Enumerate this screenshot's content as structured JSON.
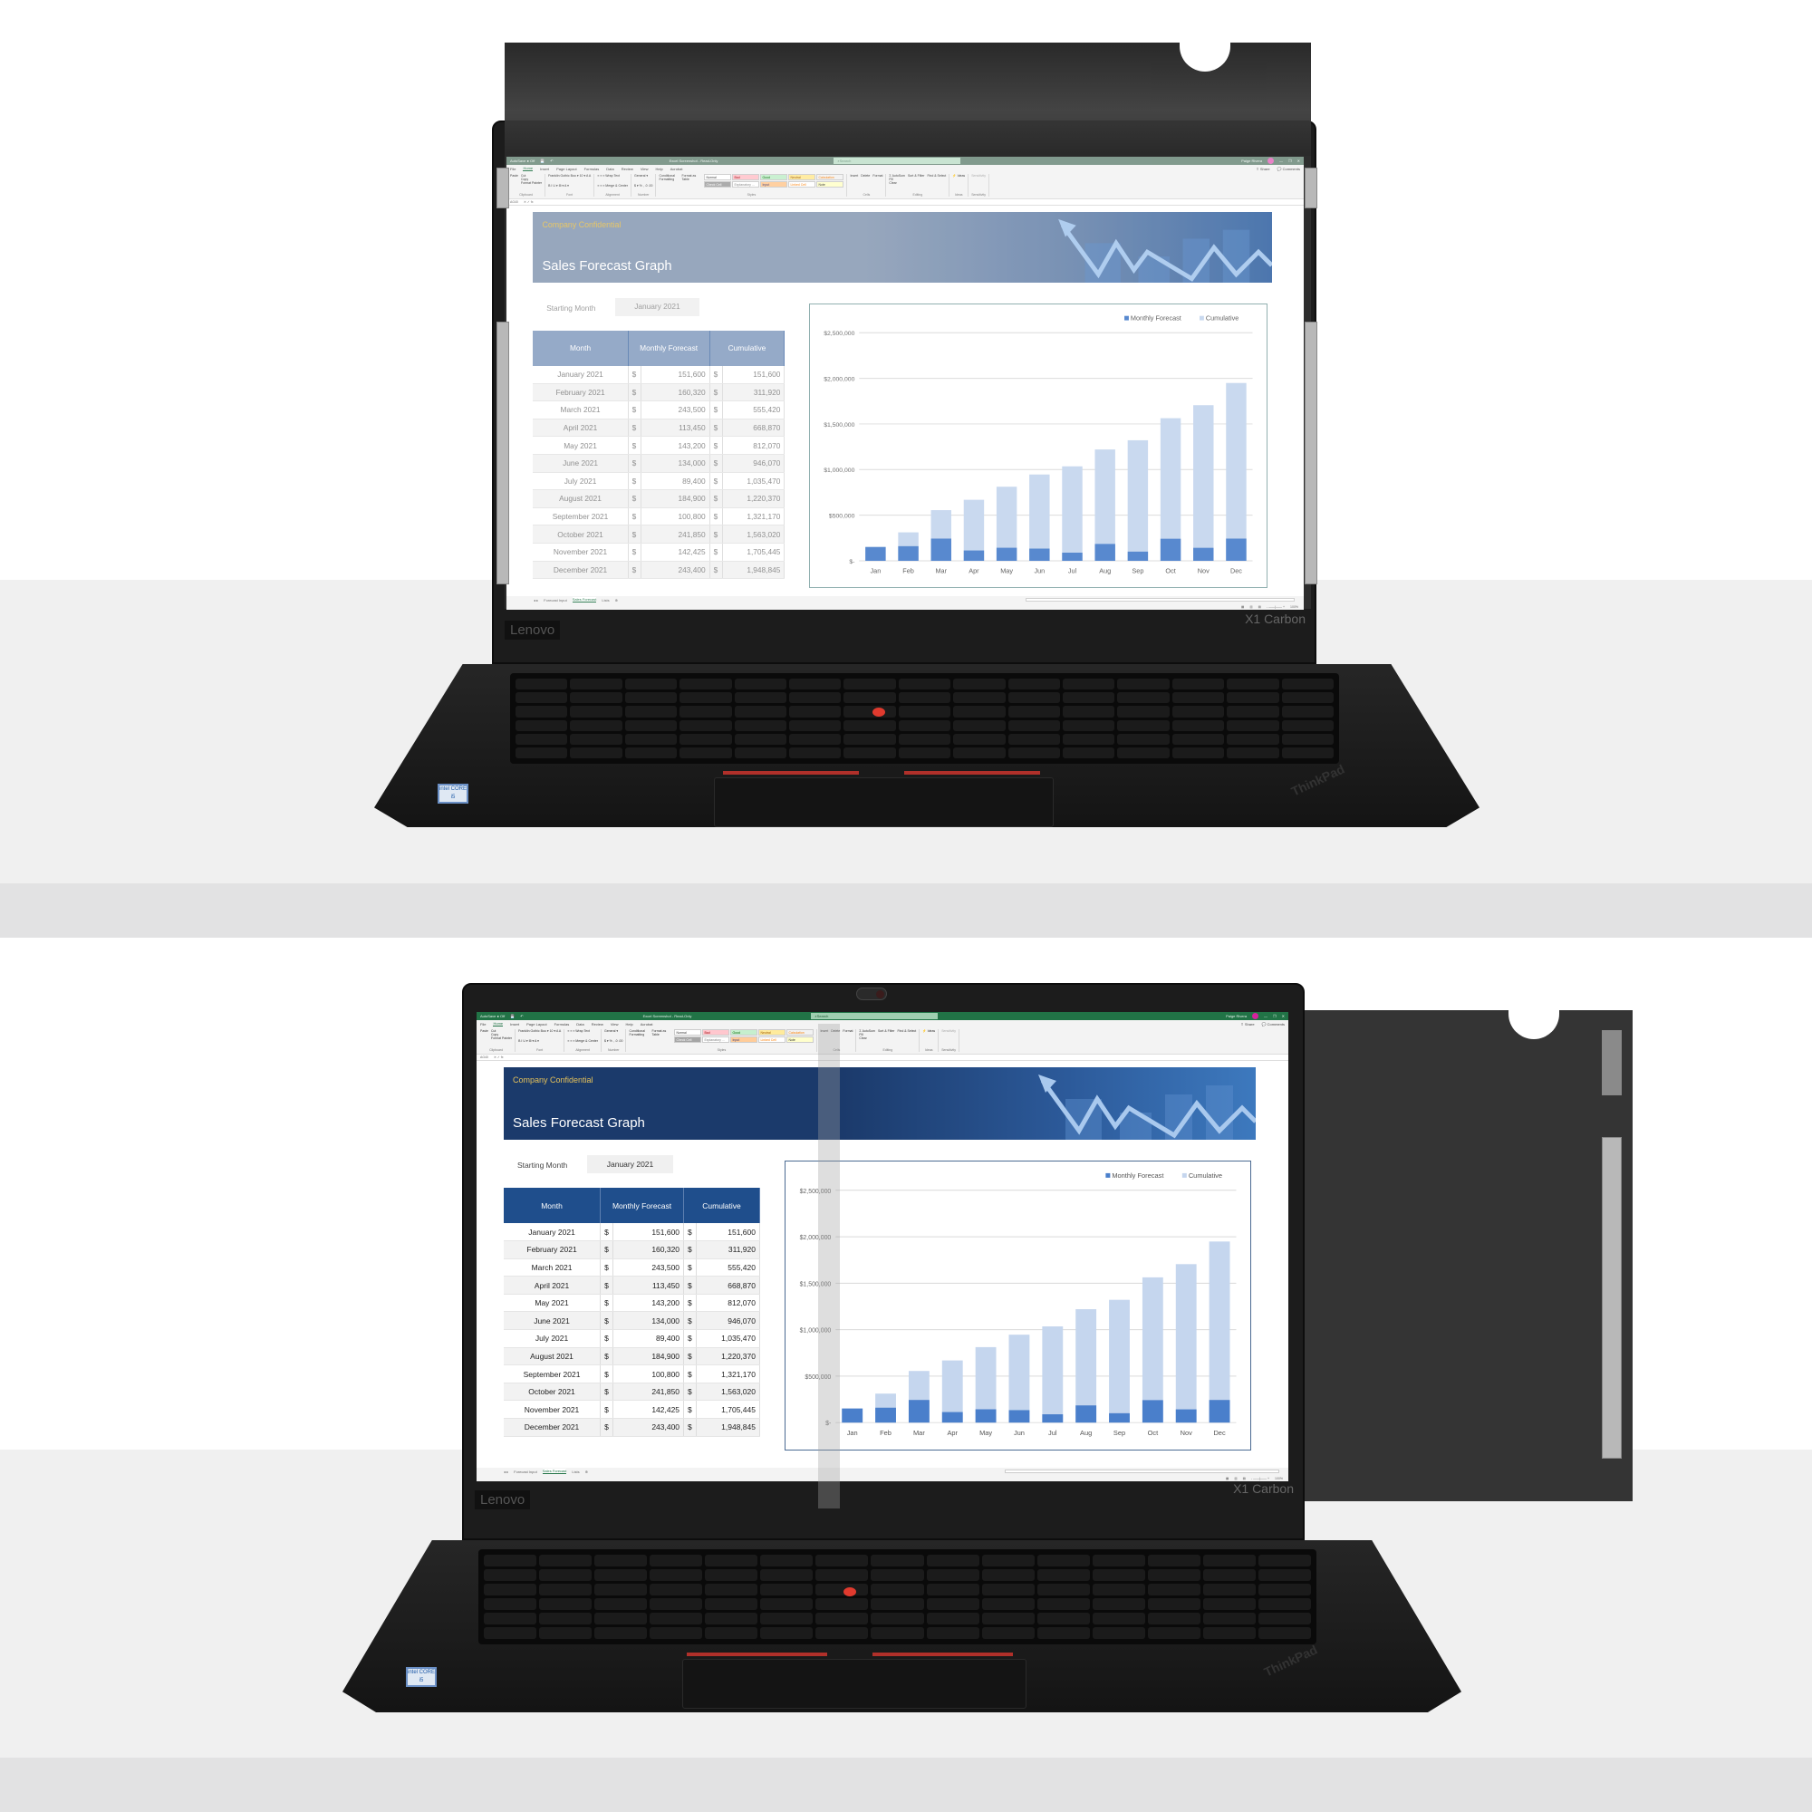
{
  "product_scene": {
    "laptop_brand": "Lenovo",
    "laptop_model": "X1 Carbon",
    "keyboard_logo": "ThinkPad",
    "sticker": "intel CORE i5",
    "top_panel_state": "privacy filter attached (screen washed out)",
    "bottom_panel_state": "privacy filter removed (screen clear)"
  },
  "excel": {
    "autosave_label": "AutoSave",
    "autosave_state": "Off",
    "file_title": "Excel Screenshot - Read-Only",
    "search_placeholder": "Search",
    "user_name": "Paige Rivera",
    "user_initials": "PR",
    "window_controls": [
      "—",
      "❐",
      "✕"
    ],
    "menu_tabs": [
      "File",
      "Home",
      "Insert",
      "Page Layout",
      "Formulas",
      "Data",
      "Review",
      "View",
      "Help",
      "Acrobat"
    ],
    "active_tab": "Home",
    "share_label": "Share",
    "comments_label": "Comments",
    "ribbon": {
      "clipboard": {
        "label": "Clipboard",
        "items": [
          "Paste",
          "Cut",
          "Copy",
          "Format Painter"
        ]
      },
      "font": {
        "label": "Font",
        "font_name": "Franklin Gothic Boo",
        "font_size": "10"
      },
      "alignment": {
        "label": "Alignment",
        "items": [
          "Wrap Text",
          "Merge & Center"
        ]
      },
      "number": {
        "label": "Number",
        "format": "General"
      },
      "styles": {
        "label": "Styles",
        "buttons": [
          "Conditional Formatting",
          "Format as Table"
        ],
        "cells": [
          {
            "name": "Normal",
            "color": "#ffffff"
          },
          {
            "name": "Bad",
            "color": "#ffc7ce"
          },
          {
            "name": "Good",
            "color": "#c6efce"
          },
          {
            "name": "Neutral",
            "color": "#ffeb9c"
          },
          {
            "name": "Calculation",
            "color": "#f2f2f2"
          },
          {
            "name": "Check Cell",
            "color": "#a5a5a5"
          },
          {
            "name": "Explanatory ...",
            "color": "#ffffff"
          },
          {
            "name": "Input",
            "color": "#ffcc99"
          },
          {
            "name": "Linked Cell",
            "color": "#ffffff"
          },
          {
            "name": "Note",
            "color": "#ffffcc"
          }
        ]
      },
      "cells": {
        "label": "Cells",
        "items": [
          "Insert",
          "Delete",
          "Format"
        ]
      },
      "editing": {
        "label": "Editing",
        "items": [
          "AutoSum",
          "Fill",
          "Clear",
          "Sort & Filter",
          "Find & Select"
        ]
      },
      "ideas": {
        "label": "Ideas",
        "items": [
          "Ideas"
        ]
      },
      "sensitivity": {
        "label": "Sensitivity",
        "items": [
          "Sensitivity"
        ]
      }
    },
    "name_box": "AG40",
    "sheet": {
      "banner_tag": "Company Confidential",
      "banner_title": "Sales Forecast Graph",
      "starting_month_label": "Starting Month",
      "starting_month_value": "January 2021",
      "table": {
        "headers": [
          "Month",
          "Monthly Forecast",
          "Cumulative"
        ],
        "currency": "$",
        "rows": [
          [
            "January 2021",
            "151,600",
            "151,600"
          ],
          [
            "February 2021",
            "160,320",
            "311,920"
          ],
          [
            "March 2021",
            "243,500",
            "555,420"
          ],
          [
            "April 2021",
            "113,450",
            "668,870"
          ],
          [
            "May 2021",
            "143,200",
            "812,070"
          ],
          [
            "June 2021",
            "134,000",
            "946,070"
          ],
          [
            "July 2021",
            "89,400",
            "1,035,470"
          ],
          [
            "August 2021",
            "184,900",
            "1,220,370"
          ],
          [
            "September 2021",
            "100,800",
            "1,321,170"
          ],
          [
            "October 2021",
            "241,850",
            "1,563,020"
          ],
          [
            "November 2021",
            "142,425",
            "1,705,445"
          ],
          [
            "December 2021",
            "243,400",
            "1,948,845"
          ]
        ]
      }
    },
    "sheet_tabs": [
      "Forecast Input",
      "Sales Forecast",
      "Lists"
    ],
    "active_sheet": "Sales Forecast",
    "zoom_level": "100%"
  },
  "colors": {
    "excel_green": "#217346",
    "banner_navy": "#1b3a6b",
    "banner_tag_gold": "#e6c25a",
    "table_header": "#1f4e8c",
    "monthly_bar": "#4a7fcb",
    "cumulative_bar": "#c5d6ee",
    "filter_black": "#2e2e2e"
  },
  "chart_data": {
    "type": "bar",
    "title": "",
    "xlabel": "",
    "ylabel": "",
    "categories": [
      "Jan",
      "Feb",
      "Mar",
      "Apr",
      "May",
      "Jun",
      "Jul",
      "Aug",
      "Sep",
      "Oct",
      "Nov",
      "Dec"
    ],
    "series": [
      {
        "name": "Monthly Forecast",
        "values": [
          151600,
          160320,
          243500,
          113450,
          143200,
          134000,
          89400,
          184900,
          100800,
          241850,
          142425,
          243400
        ]
      },
      {
        "name": "Cumulative",
        "values": [
          151600,
          311920,
          555420,
          668870,
          812070,
          946070,
          1035470,
          1220370,
          1321170,
          1563020,
          1705445,
          1948845
        ]
      }
    ],
    "overlap": true,
    "yticks": [
      0,
      500000,
      1000000,
      1500000,
      2000000,
      2500000
    ],
    "ytick_labels": [
      "$-",
      "$500,000",
      "$1,000,000",
      "$1,500,000",
      "$2,000,000",
      "$2,500,000"
    ],
    "ylim": [
      0,
      2500000
    ],
    "grid": true,
    "legend": "top-right"
  }
}
